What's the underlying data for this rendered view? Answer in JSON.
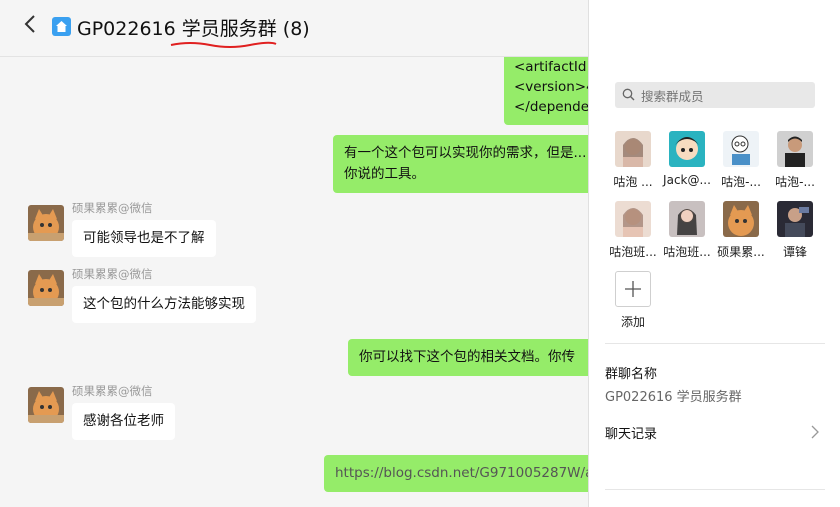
{
  "header": {
    "title": "GP022616 学员服务群 (8)",
    "back_icon": "chevron-left-icon",
    "home_icon": "house-icon",
    "more_icon": "ellipsis-icon",
    "window_controls": [
      "pin-screen-icon",
      "pin-icon",
      "minimize-icon",
      "maximize-icon",
      "close-icon"
    ]
  },
  "chat": {
    "xml_lines": [
      "<artifactId",
      "<version>4",
      "</depende"
    ],
    "messages": [
      {
        "side": "right",
        "text_line1": "有一个这个包可以实现你的需求，但是...",
        "text_line2": "你说的工具。"
      },
      {
        "side": "left",
        "sender": "硕果累累@微信",
        "text": "可能领导也是不了解"
      },
      {
        "side": "left",
        "sender": "硕果累累@微信",
        "text": "这个包的什么方法能够实现"
      },
      {
        "side": "right",
        "text": "你可以找下这个包的相关文档。你传"
      },
      {
        "side": "left",
        "sender": "硕果累累@微信",
        "text": "感谢各位老师"
      },
      {
        "side": "right",
        "text": "https://blog.csdn.net/G971005287W/a"
      }
    ]
  },
  "panel": {
    "search_placeholder": "搜索群成员",
    "members": [
      "咕泡 ...",
      "Jack@...",
      "咕泡-...",
      "咕泡-...",
      "咕泡班...",
      "咕泡班...",
      "硕果累...",
      "谭锋"
    ],
    "add_label": "添加",
    "group_name_label": "群聊名称",
    "group_name_value": "GP022616 学员服务群",
    "chat_history_label": "聊天记录"
  },
  "colors": {
    "bubble_green": "#95ec69",
    "home_icon_blue": "#3aa0f0",
    "annotation_red": "#e02020"
  }
}
